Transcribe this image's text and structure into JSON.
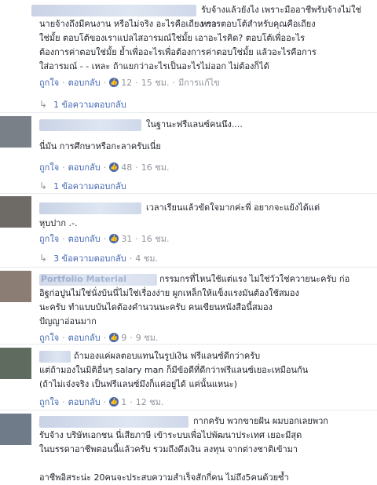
{
  "comments": [
    {
      "text_first": "รับจ้างแล้วยังไง เพราะมืออาชีพรับจ้างไม่ใช่หรอ",
      "text_rest": "นายจ้างถึงมีคนงาน หรือไม่จริง อะไรคือเถียง การตอบโต้สำหรับคุณคือเถียง\nใช่มั้ย ตอบโต้ของเราแปลไสอารมณ์ใช่มั้ย เอาอะไรคิด? ตอบโต้เพื่ออะไร\nต้องการค่าตอบใช่มั้ย ย้ำเพื่ออะไรเพื่อต้องการค่าตอบใช่มั้ย แล้วอะไรคือการ\nใส่อารมณ์ - - เหละ ถ้าแยกว่าอะไรเป็นอะไรไม่ออก ไม่ต้องก็ได้",
      "like": "ถูกใจ",
      "reply": "ตอบกลับ",
      "likes": "12",
      "time": "15 ชม.",
      "edited": "มีการแก้ไข",
      "replies": "1 ข้อความตอบกลับ"
    },
    {
      "text_first": "ในฐานะฟรีแลนซ์คนนึง....",
      "text_rest": "นี่มัน การศึกษาหรือกะลาครับเนี่ย",
      "like": "ถูกใจ",
      "reply": "ตอบกลับ",
      "likes": "48",
      "time": "16 ชม.",
      "replies": "1 ข้อความตอบกลับ"
    },
    {
      "text_first": "เวลาเรียนแล้วขัดใจมากค่ะพี่ อยากจะแย้งได้แต่",
      "text_rest": "หุบปาก .-.",
      "like": "ถูกใจ",
      "reply": "ตอบกลับ",
      "likes": "31",
      "time": "16 ชม.",
      "replies": "3 ข้อความตอบกลับ",
      "replies_time": "4 ชม."
    },
    {
      "name_partial": "Portfolio Material",
      "text_first": "กรรมกรที่ไหนใช้แต่แรง ไม่ใช่วัวใช่ควายนะครับ ก่อ",
      "text_rest": "อิฐก่อปูนไม่ใช่นั่งบ้นนี่ไม่ใช่เรื่องง่าย ผูกเหล็กให้แข็งแรงมันต้องใช้สมอง\nนะครับ ทำแบบบันไดต้องคำนวนนะครับ คนเขียนหนังสือนี้สมอง\nปัญญาอ่อนมาก",
      "like": "ถูกใจ",
      "reply": "ตอบกลับ",
      "likes": "9",
      "time": "9 ชม."
    },
    {
      "text_first": "ถ้ามองแค่ผลตอบแทนในรูปเงิน ฟรีแลนซ์ดีกว่าครับ",
      "text_rest": "แต่ถ้ามองในมิติอื่นๆ salary man ก็มีข้อดีที่ดีกว่าฟรีแลนซ์เยอะเหมือนกัน\n(ถ้าไม่เจ๋งจริง เป็นฟรีแลนซ์มึงก็แค่อยู่ได้ แค่นั้นแหนะ)",
      "like": "ถูกใจ",
      "reply": "ตอบกลับ",
      "likes": "1",
      "time": "12 ชม."
    },
    {
      "text_first": "กากครับ พวกขายฝัน ผมบอกเลยพวก",
      "text_rest": "รับจ้าง บริษัทเอกชน นี่เสียภาษี เข้าระบบเพื่อไปพัฒนาประเทศ เยอะมีสุด\nในบรรดาอาชีพตอนนี้แล้วครับ รวมถึงดึงเงิน ลงทุน จากต่างชาติเข้ามา\n\nอาชีพอิสระน่ะ 20คนจะประสบความสำเร็จสักกี่คน ไม่ถึง5คนด้วยซ้ำ"
    }
  ]
}
